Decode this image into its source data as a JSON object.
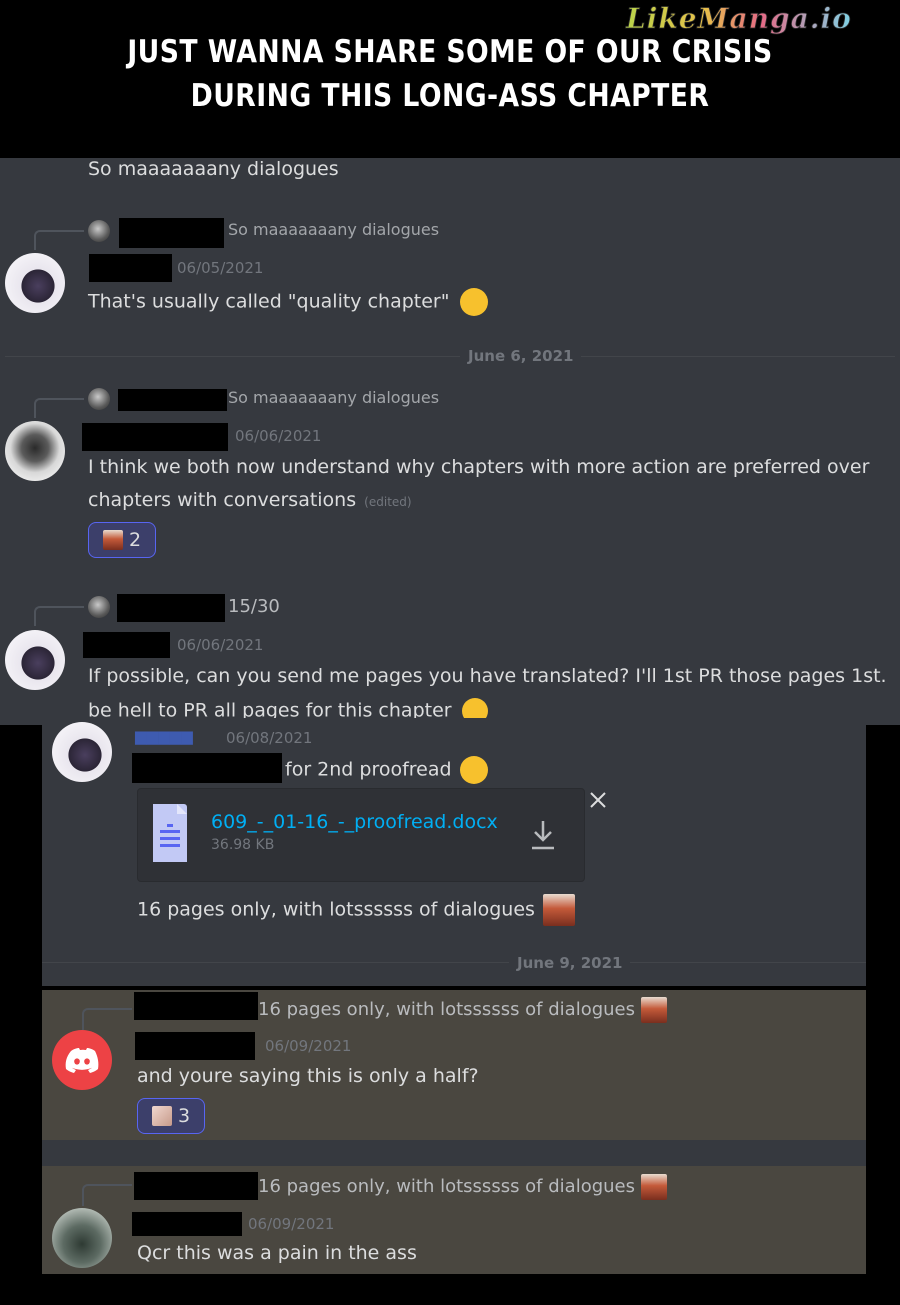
{
  "header": {
    "line1": "JUST WANNA SHARE SOME OF OUR CRISIS",
    "line2": "DURING THIS LONG-ASS CHAPTER",
    "watermark": "LikeManga.io"
  },
  "chat_top": {
    "first_line": "So maaaaaaany dialogues",
    "messages": [
      {
        "reply_text": "So maaaaaaany dialogues",
        "date": "06/05/2021",
        "text": "That's usually called \"quality chapter\""
      },
      {
        "reply_text": "So maaaaaaany dialogues",
        "date": "06/06/2021",
        "text_line1": "I think we both now understand why chapters with more action are preferred over",
        "text_line2": "chapters with conversations",
        "edited": "(edited)",
        "reaction_count": "2"
      },
      {
        "reply_text": "15/30",
        "date": "06/06/2021",
        "text_line1": "If possible, can you send me pages you have translated? I'll 1st PR those pages 1st.",
        "text_line2": "be hell to PR all pages for this chapter"
      }
    ],
    "divider_date": "June 6, 2021"
  },
  "chat_bottom": {
    "msg1": {
      "date": "06/08/2021",
      "text": "for 2nd proofread"
    },
    "file": {
      "name": "609_-_01-16_-_proofread.docx",
      "size": "36.98 KB"
    },
    "msg2": {
      "text": "16 pages only, with lotssssss of dialogues"
    },
    "divider_date": "June 9, 2021",
    "msg3": {
      "reply_text": "16 pages only, with lotssssss of dialogues",
      "date": "06/09/2021",
      "text": "and youre saying this is only a half?",
      "reaction_count": "3"
    },
    "msg4": {
      "reply_text": "16 pages only, with lotssssss of dialogues",
      "date": "06/09/2021",
      "text": "Qcr this was a pain in the ass"
    }
  },
  "colors": {
    "panel": "#36393f",
    "highlight": "#4a4740",
    "reaction_border": "#5865f2",
    "link": "#00aff4",
    "discord_red": "#ed4245"
  }
}
